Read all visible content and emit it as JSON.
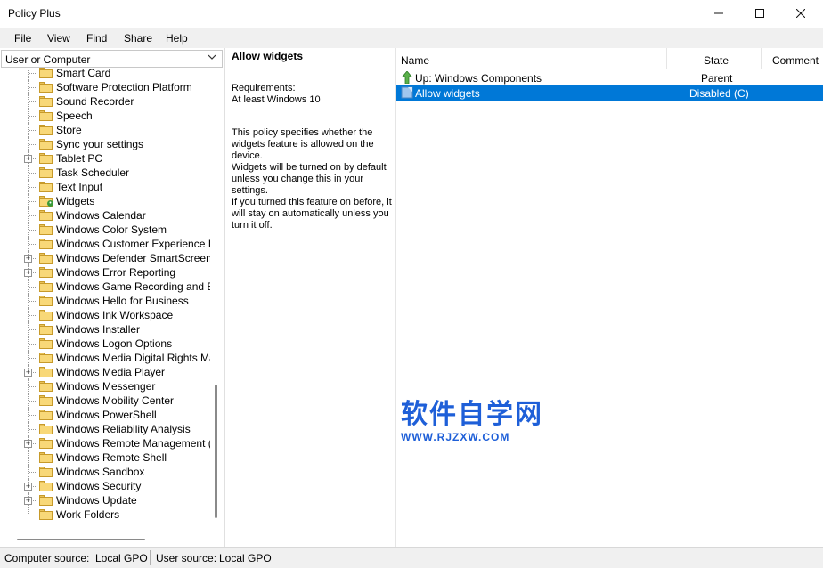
{
  "window": {
    "title": "Policy Plus"
  },
  "menu": [
    "File",
    "View",
    "Find",
    "Share",
    "Help"
  ],
  "scope_selector": {
    "value": "User or Computer"
  },
  "tree": {
    "items": [
      {
        "label": "Smart Card",
        "expandable": false
      },
      {
        "label": "Software Protection Platform",
        "expandable": false
      },
      {
        "label": "Sound Recorder",
        "expandable": false
      },
      {
        "label": "Speech",
        "expandable": false
      },
      {
        "label": "Store",
        "expandable": false
      },
      {
        "label": "Sync your settings",
        "expandable": false
      },
      {
        "label": "Tablet PC",
        "expandable": true
      },
      {
        "label": "Task Scheduler",
        "expandable": false
      },
      {
        "label": "Text Input",
        "expandable": false
      },
      {
        "label": "Widgets",
        "expandable": false,
        "selected": true
      },
      {
        "label": "Windows Calendar",
        "expandable": false
      },
      {
        "label": "Windows Color System",
        "expandable": false
      },
      {
        "label": "Windows Customer Experience Impr",
        "expandable": false
      },
      {
        "label": "Windows Defender SmartScreen",
        "expandable": true
      },
      {
        "label": "Windows Error Reporting",
        "expandable": true
      },
      {
        "label": "Windows Game Recording and Broa",
        "expandable": false
      },
      {
        "label": "Windows Hello for Business",
        "expandable": false
      },
      {
        "label": "Windows Ink Workspace",
        "expandable": false
      },
      {
        "label": "Windows Installer",
        "expandable": false
      },
      {
        "label": "Windows Logon Options",
        "expandable": false
      },
      {
        "label": "Windows Media Digital Rights Mana",
        "expandable": false
      },
      {
        "label": "Windows Media Player",
        "expandable": true
      },
      {
        "label": "Windows Messenger",
        "expandable": false
      },
      {
        "label": "Windows Mobility Center",
        "expandable": false
      },
      {
        "label": "Windows PowerShell",
        "expandable": false
      },
      {
        "label": "Windows Reliability Analysis",
        "expandable": false
      },
      {
        "label": "Windows Remote Management (Wi",
        "expandable": true
      },
      {
        "label": "Windows Remote Shell",
        "expandable": false
      },
      {
        "label": "Windows Sandbox",
        "expandable": false
      },
      {
        "label": "Windows Security",
        "expandable": true
      },
      {
        "label": "Windows Update",
        "expandable": true
      },
      {
        "label": "Work Folders",
        "expandable": false
      }
    ]
  },
  "description": {
    "title": "Allow widgets",
    "requirements_label": "Requirements:",
    "requirements_value": "At least Windows 10",
    "text": "This policy specifies whether the widgets feature is allowed on the device.\nWidgets will be turned on by default unless you change this in your settings.\nIf you turned this feature on before, it will stay on automatically unless you turn it off."
  },
  "list": {
    "columns": {
      "name": "Name",
      "state": "State",
      "comment": "Comment"
    },
    "rows": [
      {
        "name": "Up: Windows Components",
        "state": "Parent",
        "icon": "up-arrow-icon"
      },
      {
        "name": "Allow widgets",
        "state": "Disabled (C)",
        "icon": "policy-icon",
        "selected": true
      }
    ]
  },
  "watermark": {
    "cn": "软件自学网",
    "en": "WWW.RJZXW.COM"
  },
  "status": {
    "computer_label": "Computer source:",
    "computer_value": "Local GPO",
    "user_label": "User source:",
    "user_value": "Local GPO"
  },
  "colors": {
    "selection": "#0078d7",
    "folder": "#f8d878",
    "watermark": "#1e5fd8"
  }
}
